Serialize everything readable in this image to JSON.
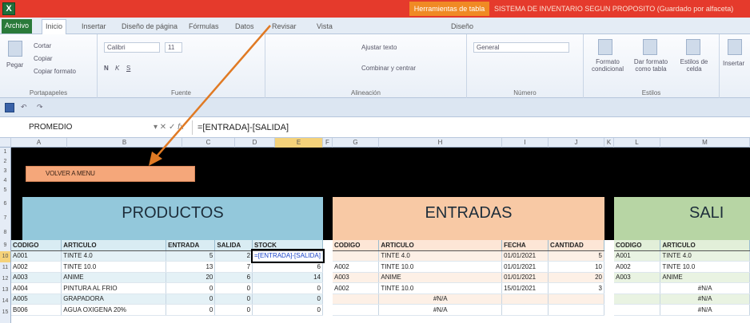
{
  "titlebar": {
    "app_icon": "X",
    "context_tab": "Herramientas de tabla",
    "doc_title": "SISTEMA DE INVENTARIO SEGUN PROPOSITO (Guardado por alfaceta)"
  },
  "ribbon_tabs": [
    "Archivo",
    "Inicio",
    "Insertar",
    "Diseño de página",
    "Fórmulas",
    "Datos",
    "Revisar",
    "Vista",
    "Diseño"
  ],
  "ribbon": {
    "clipboard": {
      "paste": "Pegar",
      "cut": "Cortar",
      "copy": "Copiar",
      "format_painter": "Copiar formato",
      "label": "Portapapeles"
    },
    "font": {
      "name": "Calibri",
      "size": "11",
      "label": "Fuente"
    },
    "alignment": {
      "wrap": "Ajustar texto",
      "merge": "Combinar y centrar",
      "label": "Alineación"
    },
    "number": {
      "format": "General",
      "label": "Número"
    },
    "styles": {
      "conditional": "Formato condicional",
      "as_table": "Dar formato como tabla",
      "cell_styles": "Estilos de celda",
      "label": "Estilos"
    },
    "cells": {
      "insert": "Insertar"
    }
  },
  "formula_bar": {
    "name_box": "PROMEDIO",
    "formula": "=[ENTRADA]-[SALIDA]"
  },
  "columns": [
    "A",
    "B",
    "C",
    "D",
    "E",
    "F",
    "G",
    "H",
    "I",
    "J",
    "K",
    "L",
    "M"
  ],
  "rows": [
    "1",
    "2",
    "3",
    "4",
    "5",
    "6",
    "7",
    "8",
    "9",
    "10",
    "11",
    "12",
    "13",
    "14",
    "15"
  ],
  "menu_button": "VOLVER A MENU",
  "sections": {
    "productos": "PRODUCTOS",
    "entradas": "ENTRADAS",
    "salidas": "SALI"
  },
  "productos": {
    "headers": [
      "CODIGO",
      "ARTICULO",
      "ENTRADA",
      "SALIDA",
      "STOCK"
    ],
    "rows": [
      [
        "A001",
        "TINTE 4.0",
        "5",
        "",
        "=[ENTRADA]-[SALIDA]"
      ],
      [
        "A002",
        "TINTE 10.0",
        "13",
        "7",
        "6"
      ],
      [
        "A003",
        "ANIME",
        "20",
        "6",
        "14"
      ],
      [
        "A004",
        "PINTURA AL FRIO",
        "0",
        "0",
        "0"
      ],
      [
        "A005",
        "GRAPADORA",
        "0",
        "0",
        "0"
      ],
      [
        "B006",
        "AGUA OXIGENA 20%",
        "0",
        "0",
        "0"
      ]
    ],
    "stock_partial": "2"
  },
  "entradas": {
    "headers": [
      "CODIGO",
      "ARTICULO",
      "FECHA",
      "CANTIDAD"
    ],
    "rows": [
      [
        "",
        "TINTE 4.0",
        "01/01/2021",
        "5"
      ],
      [
        "A002",
        "TINTE 10.0",
        "01/01/2021",
        "10"
      ],
      [
        "A003",
        "ANIME",
        "01/01/2021",
        "20"
      ],
      [
        "A002",
        "TINTE 10.0",
        "15/01/2021",
        "3"
      ],
      [
        "",
        "#N/A",
        "",
        ""
      ],
      [
        "",
        "#N/A",
        "",
        ""
      ]
    ]
  },
  "salidas": {
    "headers": [
      "CODIGO",
      "ARTICULO"
    ],
    "rows": [
      [
        "A001",
        "TINTE 4.0"
      ],
      [
        "A002",
        "TINTE 10.0"
      ],
      [
        "A003",
        "ANIME"
      ],
      [
        "",
        "#N/A"
      ],
      [
        "",
        "#N/A"
      ],
      [
        "",
        "#N/A"
      ]
    ]
  },
  "colors": {
    "title_red": "#e53a2c",
    "productos": "#93c8db",
    "entradas": "#f8c9a5",
    "salidas": "#b7d5a4",
    "arrow": "#e07a24"
  }
}
